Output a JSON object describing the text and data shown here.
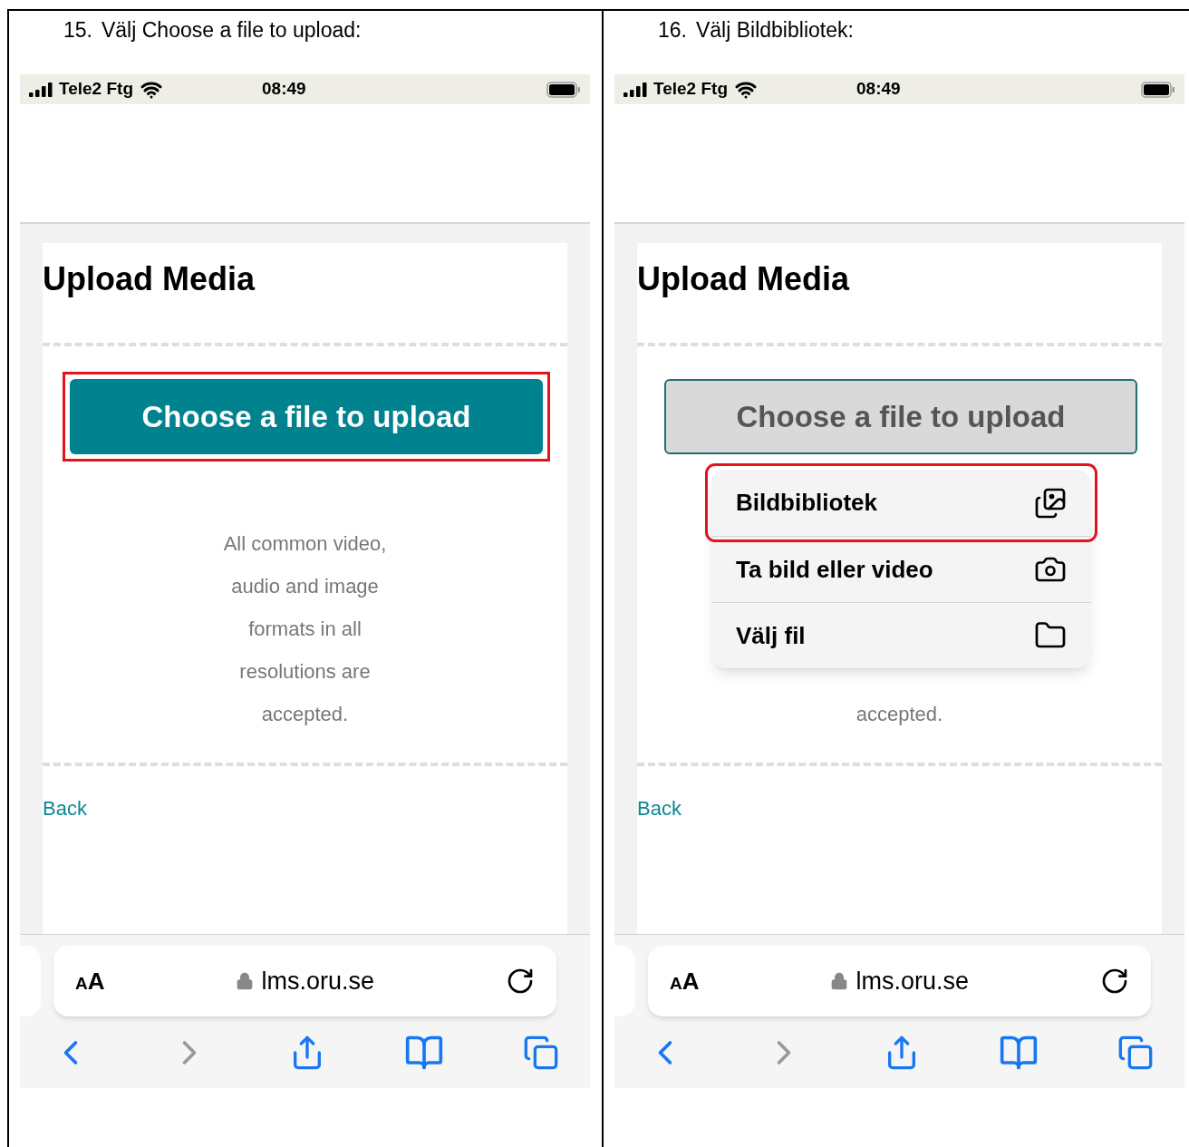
{
  "panels": [
    {
      "step": "15.",
      "instruction": "Välj Choose a file to upload:",
      "status": {
        "carrier": "Tele2 Ftg",
        "time": "08:49"
      },
      "title": "Upload Media",
      "button": {
        "label": "Choose a file to upload",
        "disabled": false,
        "highlighted": true
      },
      "description": [
        "All common video,",
        "audio and image",
        "formats in all",
        "resolutions are",
        "accepted."
      ],
      "back": "Back",
      "browser": {
        "text_size": "AA",
        "url": "lms.oru.se"
      }
    },
    {
      "step": "16.",
      "instruction": "Välj Bildbibliotek:",
      "status": {
        "carrier": "Tele2 Ftg",
        "time": "08:49"
      },
      "title": "Upload Media",
      "button": {
        "label": "Choose a file to upload",
        "disabled": true,
        "highlighted": false
      },
      "description": [
        "accepted."
      ],
      "back": "Back",
      "browser": {
        "text_size": "AA",
        "url": "lms.oru.se"
      },
      "menu": [
        {
          "label": "Bildbibliotek",
          "kind": "photos",
          "highlighted": true
        },
        {
          "label": "Ta bild eller video",
          "kind": "camera",
          "highlighted": false
        },
        {
          "label": "Välj fil",
          "kind": "folder",
          "highlighted": false
        }
      ]
    }
  ]
}
